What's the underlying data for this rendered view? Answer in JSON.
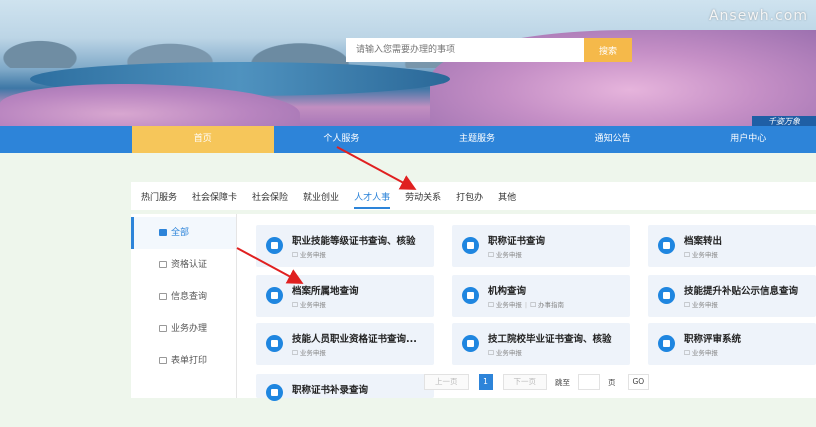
{
  "banner": {
    "watermark": "Ansewh.com",
    "corner_text": "千姿万象",
    "search_placeholder": "请输入您需要办理的事项",
    "search_button": "搜索"
  },
  "nav": {
    "items": [
      "首页",
      "个人服务",
      "主题服务",
      "通知公告",
      "用户中心"
    ],
    "active_index": 0
  },
  "categories": {
    "items": [
      "热门服务",
      "社会保障卡",
      "社会保险",
      "就业创业",
      "人才人事",
      "劳动关系",
      "打包办",
      "其他"
    ],
    "active_index": 4
  },
  "sidebar": {
    "items": [
      "全部",
      "资格认证",
      "信息查询",
      "业务办理",
      "表单打印"
    ],
    "active_index": 0
  },
  "cards": [
    {
      "title": "职业技能等级证书查询、核验",
      "tags": [
        "业务申报"
      ]
    },
    {
      "title": "职称证书查询",
      "tags": [
        "业务申报"
      ]
    },
    {
      "title": "档案转出",
      "tags": [
        "业务申报"
      ]
    },
    {
      "title": "档案所属地查询",
      "tags": [
        "业务申报"
      ]
    },
    {
      "title": "机构查询",
      "tags": [
        "业务申报",
        "办事指南"
      ]
    },
    {
      "title": "技能提升补贴公示信息查询",
      "tags": [
        "业务申报"
      ]
    },
    {
      "title": "技能人员职业资格证书查询...",
      "tags": [
        "业务申报"
      ]
    },
    {
      "title": "技工院校毕业证书查询、核验",
      "tags": [
        "业务申报"
      ]
    },
    {
      "title": "职称评审系统",
      "tags": [
        "业务申报"
      ]
    },
    {
      "title": "职称证书补录查询",
      "tags": []
    }
  ],
  "pager": {
    "prev": "上一页",
    "current": "1",
    "next": "下一页",
    "jump_label": "跳至",
    "page_label": "页",
    "go": "GO"
  },
  "colors": {
    "primary": "#2d84d9",
    "accent": "#f6c65a",
    "annotation_arrow": "#e02020"
  }
}
